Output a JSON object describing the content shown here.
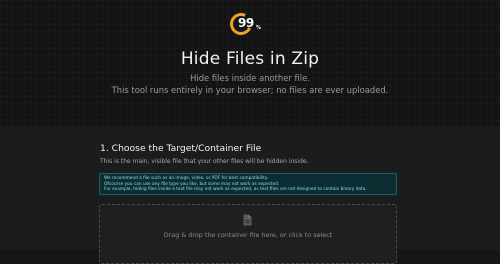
{
  "logo": {
    "mark": "99",
    "suffix": "%"
  },
  "header": {
    "title": "Hide Files in Zip",
    "subtitle_line1": "Hide files inside another file.",
    "subtitle_line2": "This tool runs entirely in your browser; no files are ever uploaded."
  },
  "step1": {
    "title": "1. Choose the Target/Container File",
    "description": "This is the main, visible file that your other files will be hidden inside.",
    "notice": [
      "We recommend a file such as an image, video, or PDF for best compatibility.",
      "Ofcourse you can use any file type you like, but some may not work as expected.",
      "For example, hiding files inside a text file may not work as expected, as text files are not designed to contain binary data."
    ],
    "dropzone_text": "Drag & drop the container file here, or click to select",
    "dropzone_icon": "file-icon"
  },
  "colors": {
    "accent": "#f0a22c",
    "notice_bg": "#0c2e33",
    "notice_text": "#8fd9e2"
  }
}
